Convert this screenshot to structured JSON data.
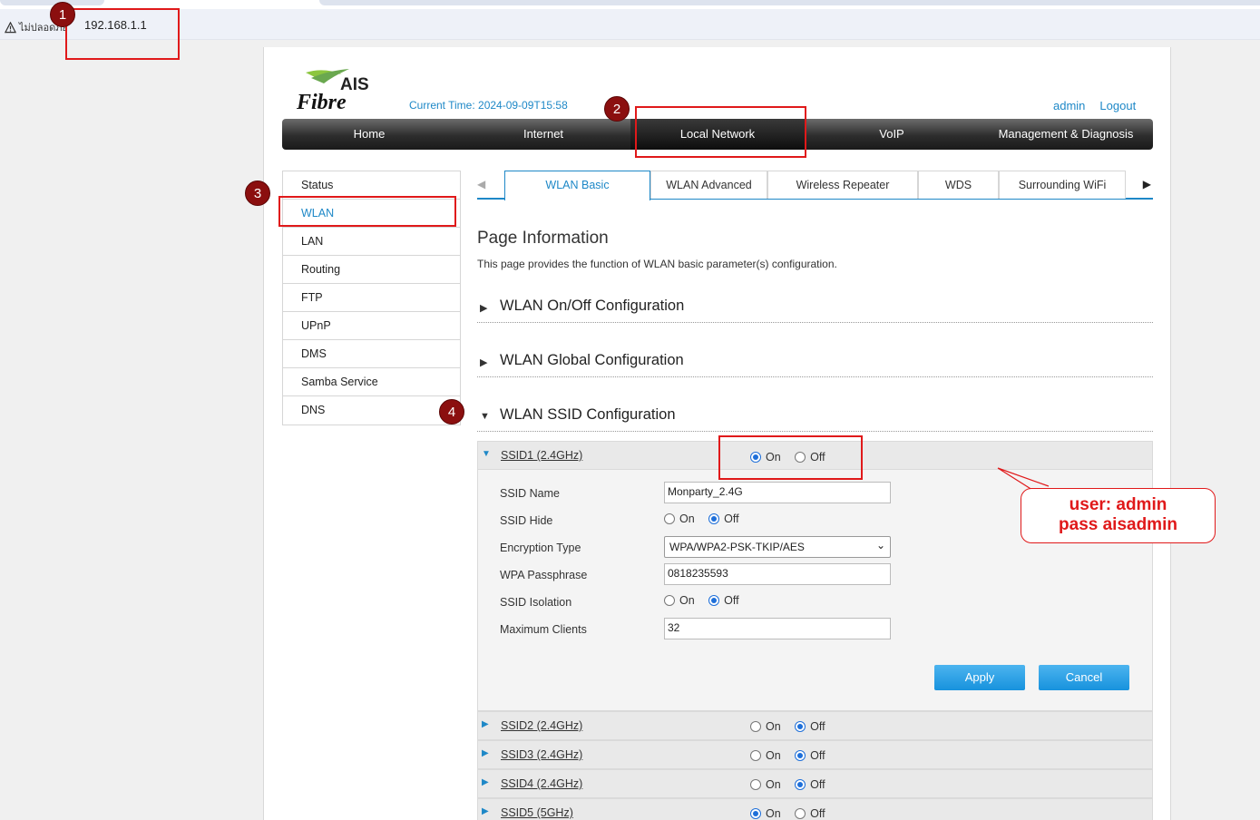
{
  "browser": {
    "security_label": "ไม่ปลอดภัย",
    "url": "192.168.1.1"
  },
  "header": {
    "logo_top": "AIS",
    "logo_bottom": "Fibre",
    "current_time": "Current Time: 2024-09-09T15:58",
    "user": "admin",
    "logout": "Logout"
  },
  "nav": {
    "items": [
      {
        "label": "Home"
      },
      {
        "label": "Internet"
      },
      {
        "label": "Local Network"
      },
      {
        "label": "VoIP"
      },
      {
        "label": "Management & Diagnosis"
      }
    ],
    "active": "Local Network"
  },
  "sidebar": {
    "items": [
      {
        "label": "Status"
      },
      {
        "label": "WLAN"
      },
      {
        "label": "LAN"
      },
      {
        "label": "Routing"
      },
      {
        "label": "FTP"
      },
      {
        "label": "UPnP"
      },
      {
        "label": "DMS"
      },
      {
        "label": "Samba Service"
      },
      {
        "label": "DNS"
      }
    ],
    "active": "WLAN"
  },
  "tabs": {
    "items": [
      {
        "label": "WLAN Basic"
      },
      {
        "label": "WLAN Advanced"
      },
      {
        "label": "Wireless Repeater"
      },
      {
        "label": "WDS"
      },
      {
        "label": "Surrounding WiFi"
      }
    ],
    "active": "WLAN Basic"
  },
  "page_info": {
    "title": "Page Information",
    "description": "This page provides the function of WLAN basic parameter(s) configuration."
  },
  "sections": [
    {
      "label": "WLAN On/Off Configuration",
      "expanded": false
    },
    {
      "label": "WLAN Global Configuration",
      "expanded": false
    },
    {
      "label": "WLAN SSID Configuration",
      "expanded": true
    }
  ],
  "radio_labels": {
    "on": "On",
    "off": "Off"
  },
  "ssids": [
    {
      "name": "SSID1 (2.4GHz)",
      "state": "On",
      "expanded": true
    },
    {
      "name": "SSID2 (2.4GHz)",
      "state": "Off"
    },
    {
      "name": "SSID3 (2.4GHz)",
      "state": "Off"
    },
    {
      "name": "SSID4 (2.4GHz)",
      "state": "Off"
    },
    {
      "name": "SSID5 (5GHz)",
      "state": "On"
    }
  ],
  "ssid1_form": {
    "ssid_name_label": "SSID Name",
    "ssid_name_value": "Monparty_2.4G",
    "ssid_hide_label": "SSID Hide",
    "ssid_hide_value": "Off",
    "encryption_label": "Encryption Type",
    "encryption_value": "WPA/WPA2-PSK-TKIP/AES",
    "passphrase_label": "WPA Passphrase",
    "passphrase_value": "0818235593",
    "isolation_label": "SSID Isolation",
    "isolation_value": "Off",
    "max_clients_label": "Maximum Clients",
    "max_clients_value": "32",
    "apply": "Apply",
    "cancel": "Cancel"
  },
  "annotations": {
    "badges": [
      "1",
      "2",
      "3",
      "4"
    ],
    "callout_line1": "user: admin",
    "callout_line2": "pass aisadmin",
    "color": "#e0191a"
  },
  "colors": {
    "accent": "#1e88c7",
    "button": "#1792dd",
    "badge": "#8b0f0f"
  }
}
